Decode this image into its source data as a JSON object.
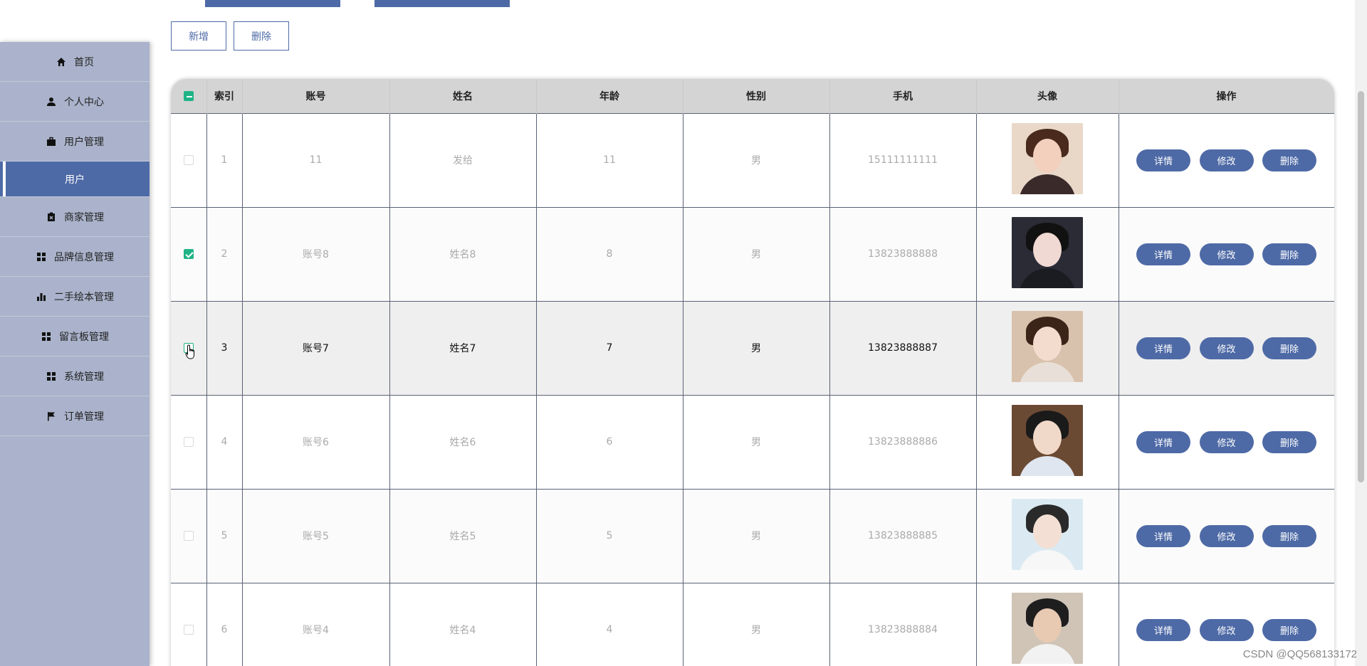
{
  "toolbar": {
    "add_label": "新增",
    "delete_label": "删除"
  },
  "sidebar": {
    "items": [
      {
        "label": "首页",
        "icon": "home-icon",
        "active": false
      },
      {
        "label": "个人中心",
        "icon": "user-icon",
        "active": false
      },
      {
        "label": "用户管理",
        "icon": "briefcase-icon",
        "active": false
      },
      {
        "label": "用户",
        "icon": "",
        "active": true
      },
      {
        "label": "商家管理",
        "icon": "clipboard-icon",
        "active": false
      },
      {
        "label": "品牌信息管理",
        "icon": "grid-icon",
        "active": false
      },
      {
        "label": "二手绘本管理",
        "icon": "bar-chart-icon",
        "active": false
      },
      {
        "label": "留言板管理",
        "icon": "grid-icon",
        "active": false
      },
      {
        "label": "系统管理",
        "icon": "grid-icon",
        "active": false
      },
      {
        "label": "订单管理",
        "icon": "flag-icon",
        "active": false
      }
    ]
  },
  "table": {
    "headers": [
      "索引",
      "账号",
      "姓名",
      "年龄",
      "性别",
      "手机",
      "头像",
      "操作"
    ],
    "rows": [
      {
        "index": "1",
        "account": "11",
        "name": "发给",
        "age": "11",
        "gender": "男",
        "phone": "15111111111",
        "checked": false
      },
      {
        "index": "2",
        "account": "账号8",
        "name": "姓名8",
        "age": "8",
        "gender": "男",
        "phone": "13823888888",
        "checked": true
      },
      {
        "index": "3",
        "account": "账号7",
        "name": "姓名7",
        "age": "7",
        "gender": "男",
        "phone": "13823888887",
        "checked": false
      },
      {
        "index": "4",
        "account": "账号6",
        "name": "姓名6",
        "age": "6",
        "gender": "男",
        "phone": "13823888886",
        "checked": false
      },
      {
        "index": "5",
        "account": "账号5",
        "name": "姓名5",
        "age": "5",
        "gender": "男",
        "phone": "13823888885",
        "checked": false
      },
      {
        "index": "6",
        "account": "账号4",
        "name": "姓名4",
        "age": "4",
        "gender": "男",
        "phone": "13823888884",
        "checked": false
      }
    ],
    "actions": {
      "detail": "详情",
      "edit": "修改",
      "delete": "删除"
    }
  },
  "watermark": "CSDN @QQ568133172",
  "colors": {
    "primary": "#4e6aa6",
    "sidebar": "#aab3cb",
    "check": "#1fb386"
  }
}
